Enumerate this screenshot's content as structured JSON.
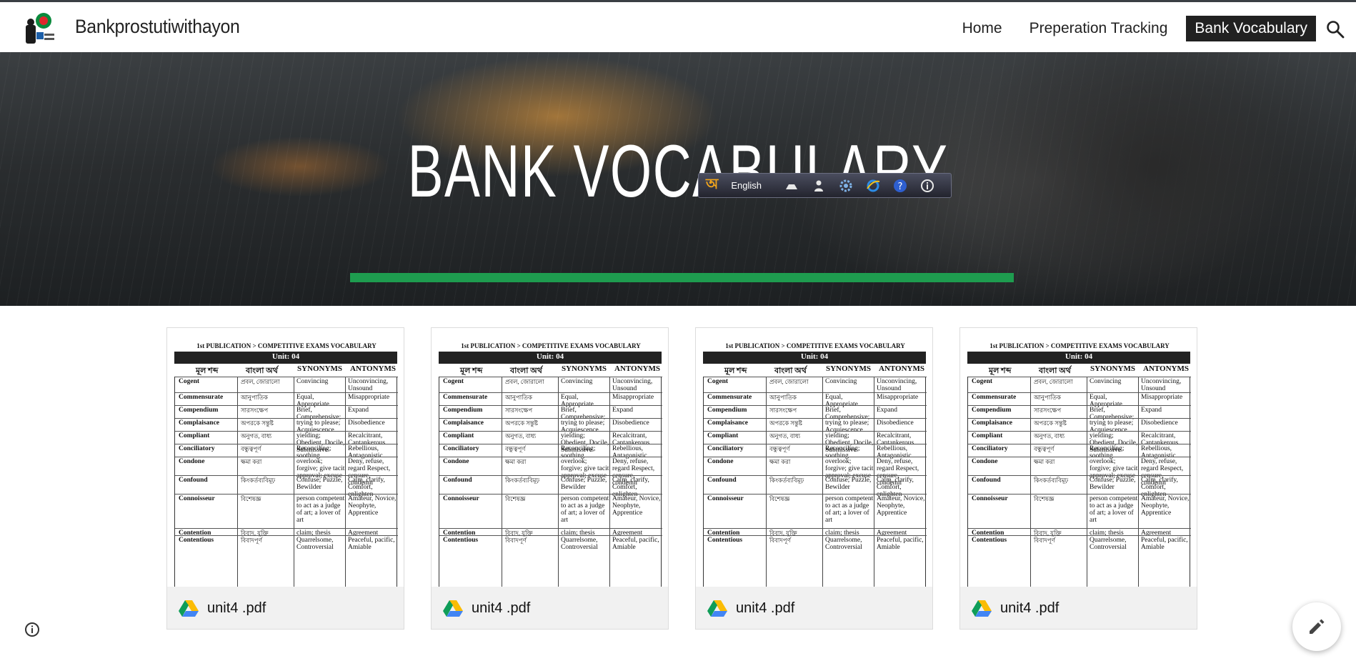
{
  "header": {
    "site_title": "Bankprostutiwithayon",
    "logo_icon": "site-logo-icon",
    "nav": [
      {
        "label": "Home",
        "active": false
      },
      {
        "label": "Preperation Tracking",
        "active": false
      },
      {
        "label": "Bank Vocabulary",
        "active": true
      }
    ],
    "search_icon": "search-icon"
  },
  "hero": {
    "title": "BANK VOCABULARY",
    "underline_color": "#1e9c4f"
  },
  "ime_toolbar": {
    "bangla_glyph": "অ",
    "language": "English",
    "icons": [
      "keyboard-icon",
      "user-icon",
      "settings-gear-icon",
      "internet-explorer-icon",
      "help-icon",
      "info-icon"
    ]
  },
  "document": {
    "header_text": "1st PUBLICATION > COMPETITIVE EXAMS VOCABULARY",
    "unit_label": "Unit: 04",
    "columns": [
      "মূল শব্দ",
      "বাংলা অর্থ",
      "SYNONYMS",
      "ANTONYMS"
    ],
    "rows": [
      {
        "word": "Cogent",
        "bn": "প্রবল, জোরালো",
        "syn": "Convincing",
        "ant": "Unconvincing, Unsound"
      },
      {
        "word": "Commensurate",
        "bn": "আনুপাতিক",
        "syn": "Equal, Appropriate",
        "ant": "Misappropriate"
      },
      {
        "word": "Compendium",
        "bn": "সারসংক্ষেপ",
        "syn": "Brief, Comprehensive;",
        "ant": "Expand"
      },
      {
        "word": "Complaisance",
        "bn": "অপরকে সন্তুষ্ট",
        "syn": "trying to please; Acquiescence",
        "ant": "Disobedience"
      },
      {
        "word": "Compliant",
        "bn": "অনুগত, বাধ্য",
        "syn": "yielding; Obedient, Docile, Submissive",
        "ant": "Recalcitrant, Cantankerous"
      },
      {
        "word": "Conciliatory",
        "bn": "বন্ধুত্বপূর্ণ",
        "syn": "Reconciling; soothing",
        "ant": "Rebellious, Antagonistic"
      },
      {
        "word": "Condone",
        "bn": "ক্ষমা করা",
        "syn": "overlook; forgive; give tacit approval; excuse",
        "ant": "Deny, refuse, regard Respect, censure, condemn"
      },
      {
        "word": "Confound",
        "bn": "কিংকর্তব্যবিমূঢ়",
        "syn": "Confuse; Puzzle, Bewilder",
        "ant": "Calm, clarify, Comfort, enlighten"
      },
      {
        "word": "Connoisseur",
        "bn": "বিশেষজ্ঞ",
        "syn": "person competent to act as a judge of art; a lover of art",
        "ant": "Amateur, Novice, Neophyte, Apprentice"
      },
      {
        "word": "Contention",
        "bn": "বিবাদ, যুক্তি",
        "syn": "claim; thesis",
        "ant": "Agreement"
      },
      {
        "word": "Contentious",
        "bn": "বিবাদপূর্ণ",
        "syn": "Quarrelsome, Controversial",
        "ant": "Peaceful, pacific, Amiable"
      }
    ]
  },
  "files": [
    {
      "name": "unit4 .pdf",
      "icon": "google-drive-icon"
    },
    {
      "name": "unit4 .pdf",
      "icon": "google-drive-icon"
    },
    {
      "name": "unit4 .pdf",
      "icon": "google-drive-icon"
    },
    {
      "name": "unit4 .pdf",
      "icon": "google-drive-icon"
    }
  ],
  "footer": {
    "info_icon": "info-circle-icon",
    "edit_icon": "pencil-icon"
  }
}
